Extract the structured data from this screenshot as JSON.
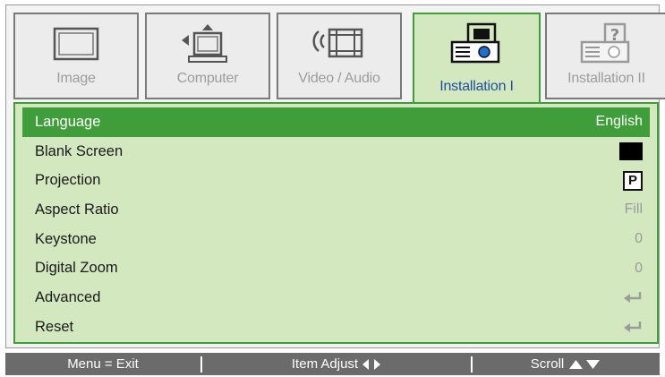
{
  "tabs": [
    {
      "label": "Image",
      "icon": "monitor-icon",
      "active": false
    },
    {
      "label": "Computer",
      "icon": "computer-icon",
      "active": false
    },
    {
      "label": "Video / Audio",
      "icon": "video-audio-icon",
      "active": false
    },
    {
      "label": "Installation I",
      "icon": "projector-icon",
      "active": true
    },
    {
      "label": "Installation II",
      "icon": "projector-help-icon",
      "active": false
    }
  ],
  "menu": {
    "rows": [
      {
        "label": "Language",
        "value": "English",
        "selected": true
      },
      {
        "label": "Blank Screen",
        "value_icon": "black-swatch-icon"
      },
      {
        "label": "Projection",
        "value": "P",
        "value_icon": "projection-mode-icon"
      },
      {
        "label": "Aspect Ratio",
        "value": "Fill"
      },
      {
        "label": "Keystone",
        "value": "0"
      },
      {
        "label": "Digital Zoom",
        "value": "0"
      },
      {
        "label": "Advanced",
        "value_icon": "enter-icon"
      },
      {
        "label": "Reset",
        "value_icon": "enter-icon"
      }
    ]
  },
  "statusbar": {
    "exit": "Menu = Exit",
    "adjust": "Item Adjust",
    "scroll": "Scroll"
  },
  "colors": {
    "accent_green": "#3f9e3a",
    "panel_green": "#d3e8bf",
    "status_gray": "#6b6b6b",
    "active_tab_text": "#1f4fa0"
  }
}
